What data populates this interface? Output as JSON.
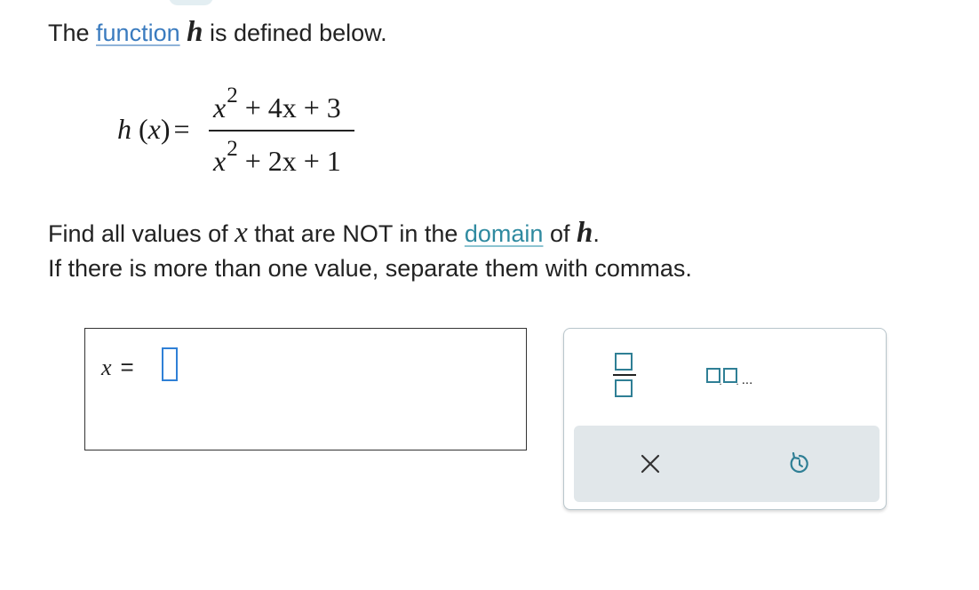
{
  "problem": {
    "intro": {
      "before": "The ",
      "link": "function",
      "var": "h",
      "after": " is defined below."
    },
    "equation": {
      "lhs_func": "h",
      "lhs_arg": "x",
      "lhs_eq": "=",
      "numerator": {
        "var": "x",
        "power": "2",
        "rest": " + 4x + 3"
      },
      "denominator": {
        "var": "x",
        "power": "2",
        "rest": " + 2x + 1"
      }
    },
    "instruction": {
      "before_x": "Find all values of ",
      "var_x": "x",
      "middle": " that are NOT in the ",
      "link": "domain",
      "of": " of ",
      "var_h": "h",
      "period": "."
    },
    "note": "If there is more than one value, separate them with commas."
  },
  "answer": {
    "var": "x",
    "eq": "=",
    "value": ""
  },
  "tools": {
    "fraction_icon": "fraction-icon",
    "list_icon": "list-icon",
    "list_ellipsis": "...",
    "clear_icon": "close-icon",
    "undo_icon": "undo-icon"
  },
  "colors": {
    "link_blue": "#3a7bbf",
    "link_teal": "#2f8aa0",
    "icon_teal": "#2f7f95",
    "cursor_blue": "#2f80d6",
    "action_strip": "#e1e7ea"
  }
}
